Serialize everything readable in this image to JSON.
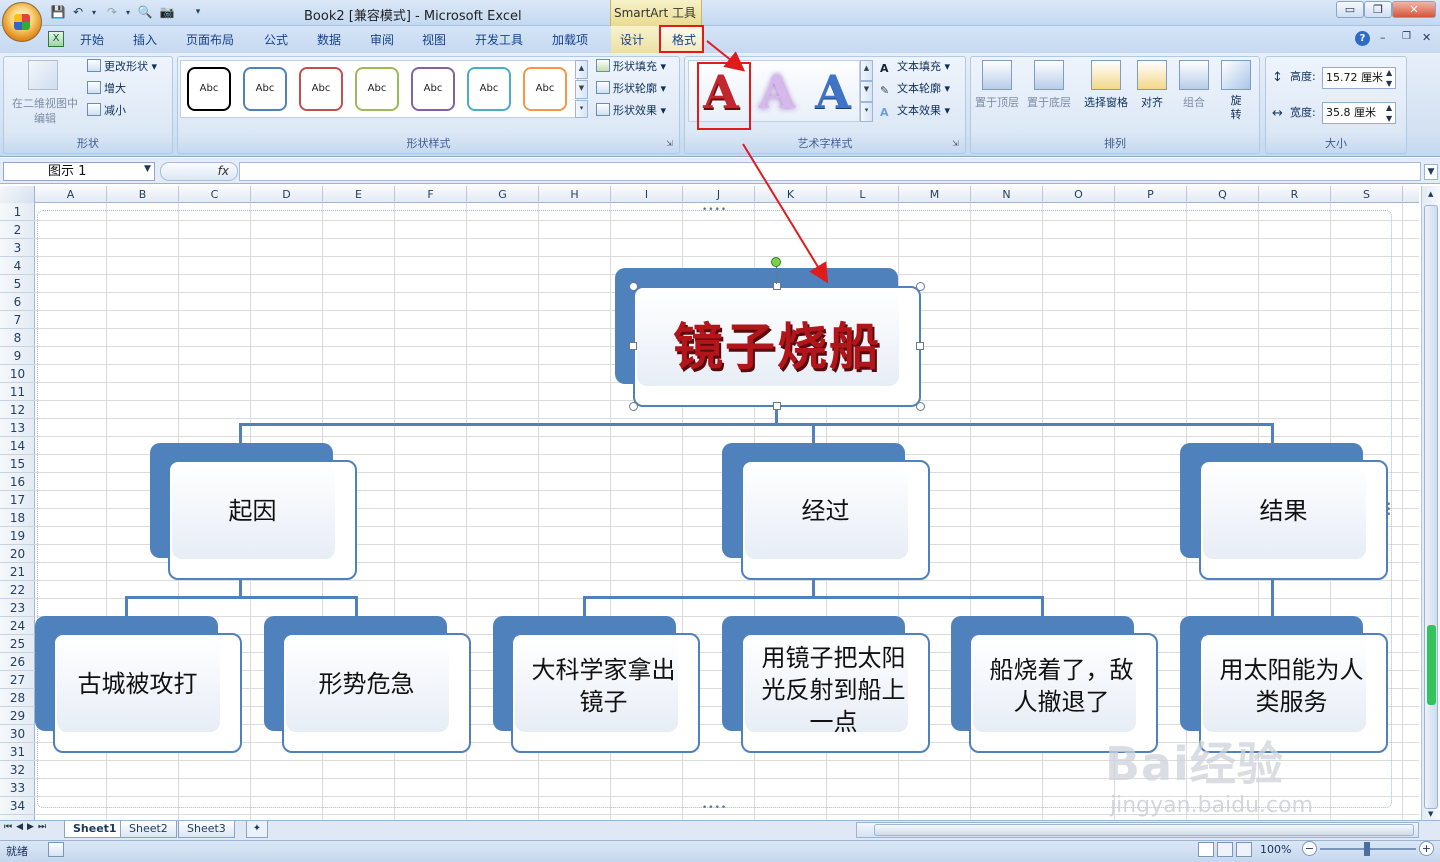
{
  "title_bar": {
    "document_title": "Book2  [兼容模式] - Microsoft Excel",
    "context_label": "SmartArt 工具"
  },
  "window_buttons": {
    "minimize": "▭",
    "restore": "❐",
    "close": "✕"
  },
  "ribbon_tabs": [
    "开始",
    "插入",
    "页面布局",
    "公式",
    "数据",
    "审阅",
    "视图",
    "开发工具",
    "加载项",
    "设计",
    "格式"
  ],
  "ribbon": {
    "shape_group": {
      "label": "形状",
      "view2d": "在二维视图中\n编辑",
      "change_shape": "更改形状",
      "larger": "增大",
      "smaller": "减小"
    },
    "shape_styles": {
      "label": "形状样式",
      "swatch_text": "Abc",
      "fill": "形状填充",
      "outline": "形状轮廓",
      "effects": "形状效果",
      "swatch_colors": [
        "#000000",
        "#4f81bd",
        "#c0504d",
        "#9bbb59",
        "#8064a2",
        "#4bacc6",
        "#f79646"
      ]
    },
    "wordart": {
      "label": "艺术字样式",
      "glyph": "A",
      "text_fill": "文本填充",
      "text_outline": "文本轮廓",
      "text_effects": "文本效果"
    },
    "arrange": {
      "label": "排列",
      "bring_front": "置于顶层",
      "send_back": "置于底层",
      "selection_pane": "选择窗格",
      "align": "对齐",
      "group": "组合",
      "rotate": "旋\n转"
    },
    "size": {
      "label": "大小",
      "height_label": "高度:",
      "height_value": "15.72 厘米",
      "width_label": "宽度:",
      "width_value": "35.8 厘米"
    }
  },
  "formula_bar": {
    "name_box": "图示 1",
    "fx": "fx",
    "content": ""
  },
  "columns": [
    "A",
    "B",
    "C",
    "D",
    "E",
    "F",
    "G",
    "H",
    "I",
    "J",
    "K",
    "L",
    "M",
    "N",
    "O",
    "P",
    "Q",
    "R",
    "S"
  ],
  "rows": [
    "1",
    "2",
    "3",
    "4",
    "5",
    "6",
    "7",
    "8",
    "9",
    "10",
    "11",
    "12",
    "13",
    "14",
    "15",
    "16",
    "17",
    "18",
    "19",
    "20",
    "21",
    "22",
    "23",
    "24",
    "25",
    "26",
    "27",
    "28",
    "29",
    "30",
    "31",
    "32",
    "33",
    "34"
  ],
  "smartart": {
    "root": "镜子烧船",
    "level2": [
      "起因",
      "经过",
      "结果"
    ],
    "level3": [
      "古城被攻打",
      "形势危急",
      "大科学家拿出\n镜子",
      "用镜子把太阳\n光反射到船上\n一点",
      "船烧着了，敌\n人撤退了",
      "用太阳能为人\n类服务"
    ]
  },
  "sheets": [
    "Sheet1",
    "Sheet2",
    "Sheet3"
  ],
  "status": {
    "ready": "就绪",
    "zoom": "100%"
  },
  "watermark": {
    "brand": "Bai经验",
    "url": "jingyan.baidu.com"
  },
  "colors": {
    "accent": "#4f81bd",
    "highlight": "#e01b1b",
    "wordart_red": "#b2161b"
  }
}
